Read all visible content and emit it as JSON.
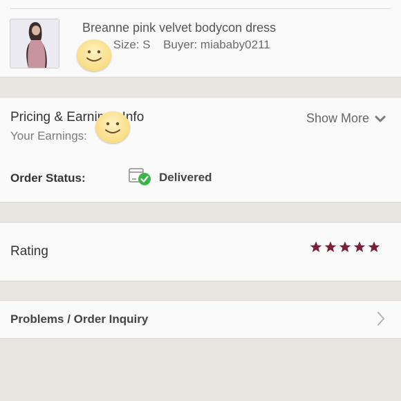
{
  "item": {
    "title": "Breanne pink velvet bodycon dress",
    "size_label": "Size: S",
    "buyer_label": "Buyer: miababy0211",
    "thumbnail_icon": "dress-photo-thumbnail"
  },
  "pricing": {
    "title": "Pricing & Earnings Info",
    "earnings_label": "Your Earnings:",
    "show_more_label": "Show More",
    "show_more_icon": "chevron-down-icon"
  },
  "order_status": {
    "label": "Order Status:",
    "value": "Delivered",
    "icon": "delivered-box-icon",
    "icon_check_color": "#3bb54a"
  },
  "rating": {
    "label": "Rating",
    "stars": 5,
    "star_color": "#7b1f36"
  },
  "problems": {
    "label": "Problems / Order Inquiry",
    "icon": "chevron-right-icon"
  },
  "colors": {
    "background": "#e9e6e2",
    "card": "#fbfafa",
    "divider": "#d9d6d3"
  }
}
